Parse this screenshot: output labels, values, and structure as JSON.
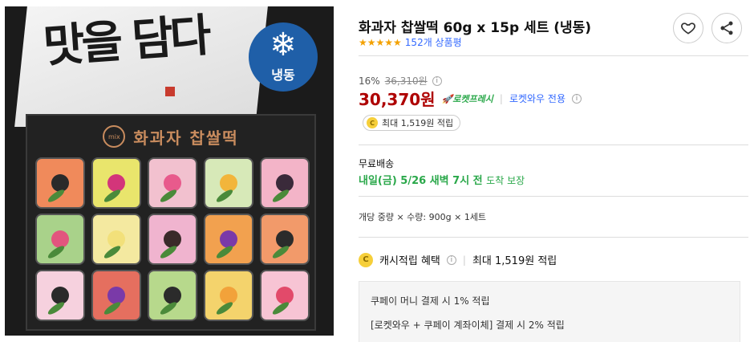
{
  "image": {
    "lid_text": "맛을 담다",
    "frozen_badge": "냉동",
    "tray_logo": "mix",
    "tray_title": "화과자 찹쌀떡"
  },
  "product": {
    "title": "화과자 찹쌀떡 60g x 15p 세트 (냉동)",
    "stars": "★★★★★",
    "review_count": "152개 상품평"
  },
  "pricing": {
    "discount_rate": "16%",
    "original_price": "36,310원",
    "price": "30,370원",
    "rocket_badge": "로켓프레시",
    "wow_only": "로켓와우 전용"
  },
  "cash_chip": "최대 1,519원 적립",
  "shipping": {
    "label": "무료배송",
    "arrival": "내일(금) 5/26 새벽 7시 전",
    "guarantee": "도착 보장"
  },
  "quantity_info": "개당 중량 × 수량: 900g × 1세트",
  "cash_benefit": {
    "label": "캐시적립 혜택",
    "amount": "최대 1,519원 적립"
  },
  "benefit_lines": [
    "쿠페이 머니 결제 시 1% 적립",
    "[로켓와우 + 쿠페이 계좌이체] 결제 시 2% 적립"
  ],
  "colors": {
    "price": "#ae0000",
    "link": "#346aff",
    "delivery": "#2aa84a",
    "star": "#f3a100",
    "frozen_badge": "#1f5fa8"
  },
  "icons": [
    "heart-icon",
    "share-icon",
    "info-icon",
    "coin-icon",
    "rocket-icon",
    "snowflake-icon"
  ]
}
